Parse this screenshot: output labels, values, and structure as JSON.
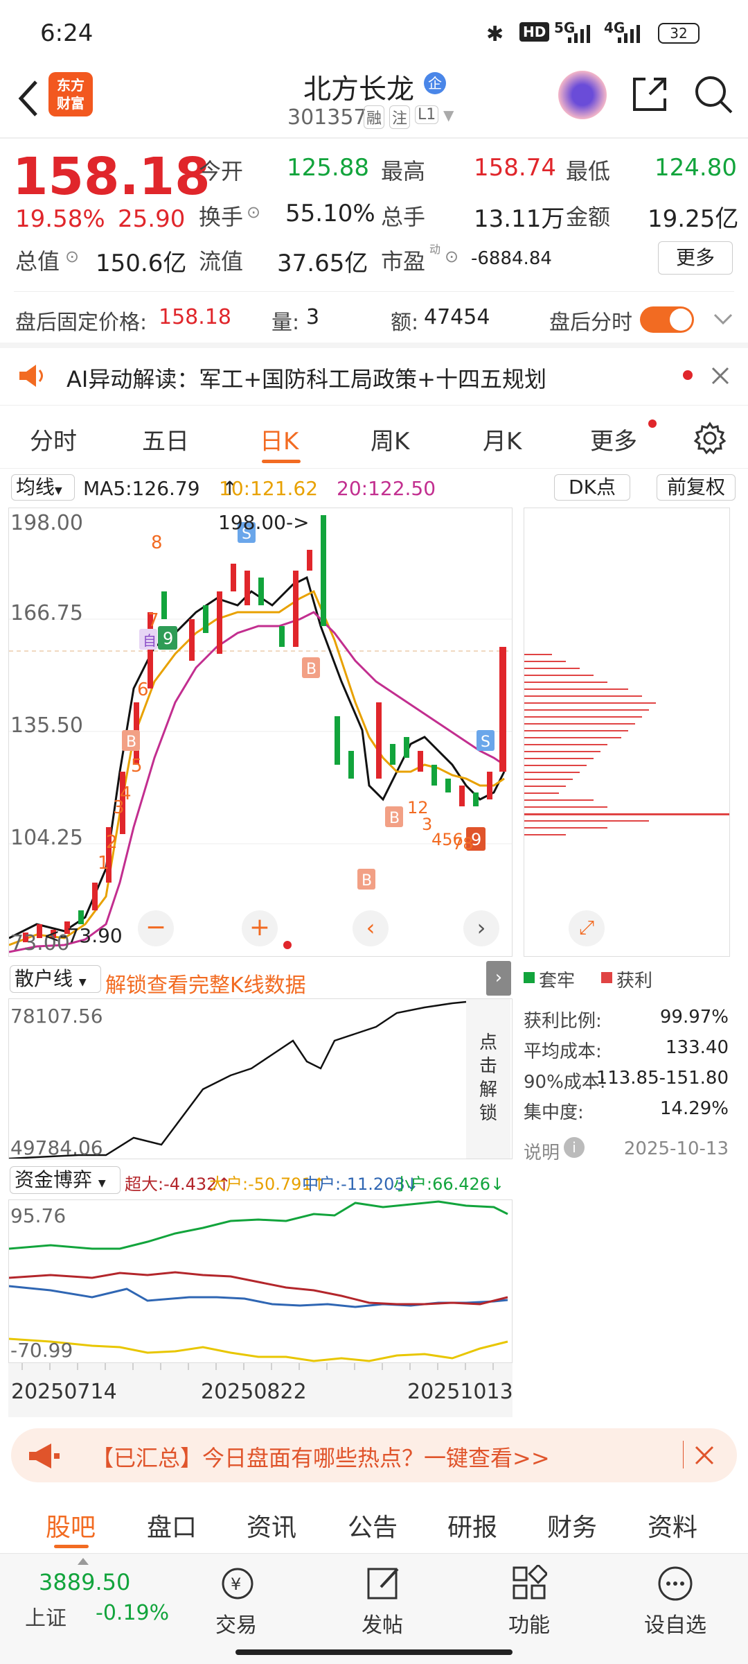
{
  "status": {
    "time": "6:24",
    "network1": "HD",
    "signal1": "5G",
    "signal2": "4G",
    "battery": "32"
  },
  "header": {
    "logo_line1": "东方",
    "logo_line2": "财富",
    "stock_name": "北方长龙",
    "badge": "企",
    "code": "301357",
    "tag1": "融",
    "tag2": "注",
    "tag3": "L1"
  },
  "quote": {
    "price": "158.18",
    "pct": "19.58%",
    "change": "25.90",
    "open_label": "今开",
    "open": "125.88",
    "high_label": "最高",
    "high": "158.74",
    "low_label": "最低",
    "low": "124.80",
    "turnover_label": "换手",
    "turnover": "55.10%",
    "volume_label": "总手",
    "volume": "13.11万",
    "amount_label": "金额",
    "amount": "19.25亿",
    "mktcap_label": "总值",
    "mktcap": "150.6亿",
    "float_label": "流值",
    "float": "37.65亿",
    "pe_label": "市盈",
    "pe_sup": "动",
    "pe": "-6884.84",
    "more": "更多"
  },
  "afterhours": {
    "label": "盘后固定价格:",
    "price": "158.18",
    "qty_label": "量:",
    "qty": "3",
    "amt_label": "额:",
    "amt": "47454",
    "toggle_label": "盘后分时"
  },
  "ai": {
    "text": "AI异动解读：军工+国防科工局政策+十四五规划"
  },
  "tabs": [
    "分时",
    "五日",
    "日K",
    "周K",
    "月K",
    "更多"
  ],
  "active_tab": "日K",
  "ma": {
    "selector": "均线",
    "ma5": "MA5:126.79",
    "ma10": "10:121.62",
    "ma20": "20:122.50",
    "dk": "DK点",
    "adjust": "前复权"
  },
  "kline": {
    "y_top": "198.00",
    "y2": "166.75",
    "y3": "135.50",
    "y4": "104.25",
    "y_bottom": "73.00",
    "max_marker": "198.00->",
    "min_marker": "<-73.90"
  },
  "chip": {
    "legend_trapped": "套牢",
    "legend_profit": "获利",
    "rows": [
      {
        "label": "获利比例:",
        "value": "99.97%"
      },
      {
        "label": "平均成本:",
        "value": "133.40"
      },
      {
        "label": "90%成本:",
        "value": "113.85-151.80"
      },
      {
        "label": "集中度:",
        "value": "14.29%"
      }
    ],
    "note": "说明",
    "date": "2025-10-13"
  },
  "retail": {
    "selector": "散户线",
    "unlock": "解锁查看完整K线数据",
    "top": "78107.56",
    "bottom": "49784.06",
    "unlock_side": "点击解锁"
  },
  "capital": {
    "selector": "资金博弈",
    "super": "超大:-4.432↑",
    "large": "大户:-50.791↑",
    "mid": "中户:-11.203↓",
    "small": "小户:66.426↓",
    "top": "95.76",
    "bottom": "-70.99"
  },
  "dates": [
    "20250714",
    "20250822",
    "20251013"
  ],
  "banner": {
    "text": "【已汇总】今日盘面有哪些热点？一键查看>>"
  },
  "subnav": [
    "股吧",
    "盘口",
    "资讯",
    "公告",
    "研报",
    "财务",
    "资料"
  ],
  "bottom": {
    "index_value": "3889.50",
    "index_name": "上证",
    "index_pct": "-0.19%",
    "trade": "交易",
    "post": "发帖",
    "func": "功能",
    "watch": "设自选"
  }
}
